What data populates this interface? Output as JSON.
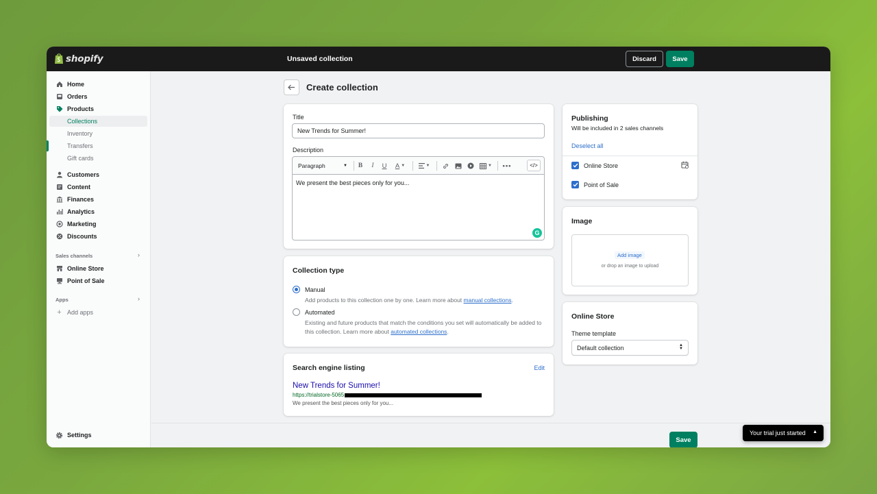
{
  "topbar": {
    "logo_text": "shopify",
    "title": "Unsaved collection",
    "discard_label": "Discard",
    "save_label": "Save"
  },
  "sidebar": {
    "items": [
      {
        "label": "Home",
        "icon": "home-icon"
      },
      {
        "label": "Orders",
        "icon": "orders-icon"
      },
      {
        "label": "Products",
        "icon": "tag-icon"
      },
      {
        "label": "Collections"
      },
      {
        "label": "Inventory"
      },
      {
        "label": "Transfers"
      },
      {
        "label": "Gift cards"
      },
      {
        "label": "Customers",
        "icon": "person-icon"
      },
      {
        "label": "Content",
        "icon": "content-icon"
      },
      {
        "label": "Finances",
        "icon": "bank-icon"
      },
      {
        "label": "Analytics",
        "icon": "bar-chart-icon"
      },
      {
        "label": "Marketing",
        "icon": "target-icon"
      },
      {
        "label": "Discounts",
        "icon": "discount-icon"
      }
    ],
    "sales_channels_heading": "Sales channels",
    "sales_channels": [
      {
        "label": "Online Store",
        "icon": "store-icon"
      },
      {
        "label": "Point of Sale",
        "icon": "pos-icon"
      }
    ],
    "apps_heading": "Apps",
    "add_apps_label": "Add apps",
    "settings_label": "Settings"
  },
  "page": {
    "title": "Create collection"
  },
  "details": {
    "title_label": "Title",
    "title_value": "New Trends for Summer!",
    "description_label": "Description",
    "paragraph_select": "Paragraph",
    "description_value": "We present the best pieces only for you..."
  },
  "collection_type": {
    "heading": "Collection type",
    "manual_label": "Manual",
    "manual_help": "Add products to this collection one by one. Learn more about ",
    "manual_link": "manual collections",
    "automated_label": "Automated",
    "automated_help": "Existing and future products that match the conditions you set will automatically be added to this collection. Learn more about ",
    "automated_link": "automated collections",
    "selected": "Manual"
  },
  "seo": {
    "heading": "Search engine listing",
    "edit_label": "Edit",
    "listing_title": "New Trends for Summer!",
    "url_prefix": "https://trialstore-5065",
    "listing_desc": "We present the best pieces only for you..."
  },
  "publishing": {
    "heading": "Publishing",
    "subtitle": "Will be included in 2 sales channels",
    "deselect_label": "Deselect all",
    "channels": [
      {
        "label": "Online Store",
        "checked": true
      },
      {
        "label": "Point of Sale",
        "checked": true
      }
    ]
  },
  "image": {
    "heading": "Image",
    "add_label": "Add image",
    "hint": "or drop an image to upload"
  },
  "online_store": {
    "heading": "Online Store",
    "theme_label": "Theme template",
    "theme_value": "Default collection"
  },
  "footer": {
    "save_label": "Save",
    "trial_label": "Your trial just started"
  },
  "colors": {
    "primary": "#008060",
    "link": "#2c6ecb",
    "topbar": "#1a1a1a"
  }
}
